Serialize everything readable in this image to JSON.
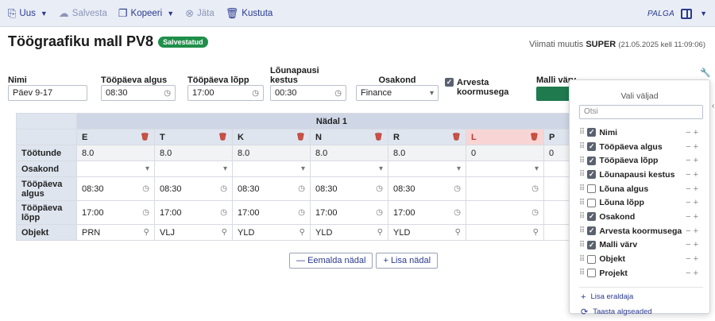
{
  "toolbar": {
    "new_label": "Uus",
    "save_label": "Salvesta",
    "copy_label": "Kopeeri",
    "skip_label": "Jäta",
    "delete_label": "Kustuta",
    "palga_label": "PALGA"
  },
  "header": {
    "title": "Töögraafiku mall PV8",
    "badge": "Salvestatud",
    "modified_prefix": "Viimati muutis",
    "modified_user": "SUPER",
    "modified_time": "(21.05.2025 kell 11:09:06)"
  },
  "form": {
    "name_label": "Nimi",
    "name_value": "Päev 9-17",
    "start_label": "Tööpäeva algus",
    "start_value": "08:30",
    "end_label": "Tööpäeva lõpp",
    "end_value": "17:00",
    "lunch_label_1": "Lõunapausi",
    "lunch_label_2": "kestus",
    "lunch_value": "00:30",
    "dept_label": "Osakond",
    "dept_value": "Finance",
    "load_label_1": "Arvesta",
    "load_label_2": "koormusega",
    "color_label": "Malli värv",
    "accent_color": "#1f7a4e"
  },
  "grid": {
    "week_label": "Nädal 1",
    "days": [
      "E",
      "T",
      "K",
      "N",
      "R",
      "L",
      "P"
    ],
    "row_labels": {
      "hours": "Töötunde",
      "dept": "Osakond",
      "start_1": "Tööpäeva",
      "start_2": "algus",
      "end_1": "Tööpäeva",
      "end_2": "lõpp",
      "object": "Objekt"
    },
    "hours": [
      "8.0",
      "8.0",
      "8.0",
      "8.0",
      "8.0",
      "0",
      "0"
    ],
    "starts": [
      "08:30",
      "08:30",
      "08:30",
      "08:30",
      "08:30",
      "",
      ""
    ],
    "ends": [
      "17:00",
      "17:00",
      "17:00",
      "17:00",
      "17:00",
      "",
      ""
    ],
    "objects": [
      "PRN",
      "VLJ",
      "YLD",
      "YLD",
      "YLD",
      "",
      ""
    ]
  },
  "week_buttons": {
    "remove": "Eemalda nädal",
    "add": "Lisa nädal"
  },
  "panel": {
    "title": "Vali väljad",
    "search_placeholder": "Otsi",
    "fields": [
      {
        "label": "Nimi",
        "checked": true
      },
      {
        "label": "Tööpäeva algus",
        "checked": true
      },
      {
        "label": "Tööpäeva lõpp",
        "checked": true
      },
      {
        "label": "Lõunapausi kestus",
        "checked": true
      },
      {
        "label": "Lõuna algus",
        "checked": false
      },
      {
        "label": "Lõuna lõpp",
        "checked": false
      },
      {
        "label": "Osakond",
        "checked": true
      },
      {
        "label": "Arvesta koormusega",
        "checked": true
      },
      {
        "label": "Malli värv",
        "checked": true
      },
      {
        "label": "Objekt",
        "checked": false
      },
      {
        "label": "Projekt",
        "checked": false
      }
    ],
    "add_separator": "Lisa eraldaja",
    "restore_defaults": "Taasta algseaded"
  }
}
